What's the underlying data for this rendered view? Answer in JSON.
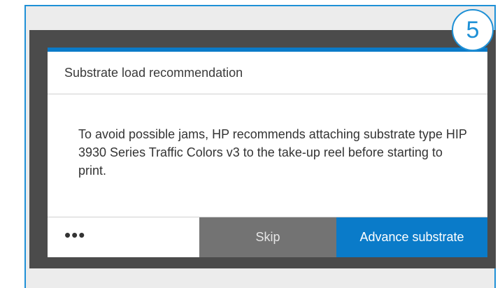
{
  "step": {
    "number": "5"
  },
  "dialog": {
    "title": "Substrate load recommendation",
    "message": "To avoid possible jams, HP recommends attaching substrate type HIP 3930 Series Traffic Colors v3 to the take-up reel before starting to print."
  },
  "buttons": {
    "more_label": "•••",
    "skip_label": "Skip",
    "advance_label": "Advance substrate"
  },
  "colors": {
    "accent": "#0a7bc9",
    "frame_border": "#1e90d6",
    "skip_button": "#737373",
    "screen_background": "#4b4b4b"
  }
}
